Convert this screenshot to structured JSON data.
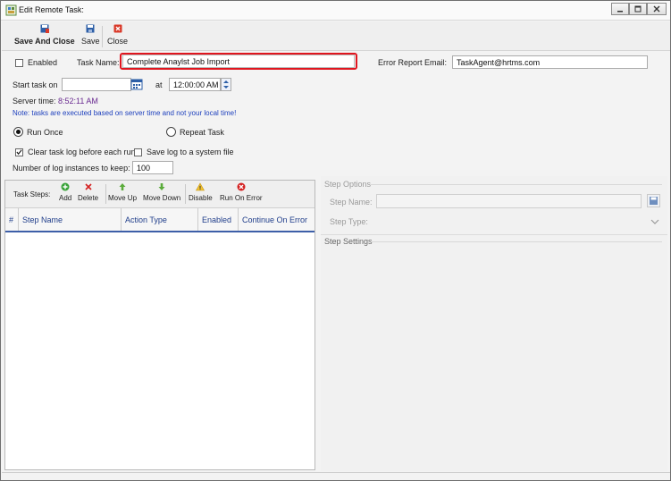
{
  "window": {
    "title": "Edit Remote Task:"
  },
  "toolbar": {
    "save_and_close_label": "Save And Close",
    "save_label": "Save",
    "close_label": "Close"
  },
  "form": {
    "enabled_label": "Enabled",
    "enabled_checked": false,
    "task_name_label": "Task Name:",
    "task_name_value": "Complete Anaylst Job Import",
    "error_email_label": "Error Report Email:",
    "error_email_value": "TaskAgent@hrtms.com",
    "start_task_label": "Start task on",
    "start_date_value": "",
    "at_label": "at",
    "start_time_value": "12:00:00 AM",
    "server_time_label": "Server time:",
    "server_time_value": "8:52:11 AM",
    "note": "Note: tasks are executed based on server time and not your local time!",
    "run_once_label": "Run Once",
    "repeat_task_label": "Repeat Task",
    "run_mode": "run_once",
    "clear_log_label": "Clear task log before each run",
    "clear_log_checked": true,
    "save_log_label": "Save log to a system file",
    "save_log_checked": false,
    "log_instances_label": "Number of log instances to keep:",
    "log_instances_value": "100"
  },
  "steps": {
    "task_steps_label": "Task Steps:",
    "buttons": {
      "add": "Add",
      "delete": "Delete",
      "move_up": "Move Up",
      "move_down": "Move Down",
      "disable": "Disable",
      "run_on_error": "Run On Error"
    },
    "columns": [
      "#",
      "Step Name",
      "Action Type",
      "Enabled",
      "Continue On Error"
    ]
  },
  "step_options": {
    "legend": "Step Options",
    "step_name_label": "Step Name:",
    "step_type_label": "Step Type:",
    "step_settings_legend": "Step Settings"
  },
  "colors": {
    "highlight": "#e0161f",
    "note_blue": "#1c3fbd",
    "server_time_purple": "#6a2b91",
    "grid_header_accent": "#3d5fa8"
  }
}
